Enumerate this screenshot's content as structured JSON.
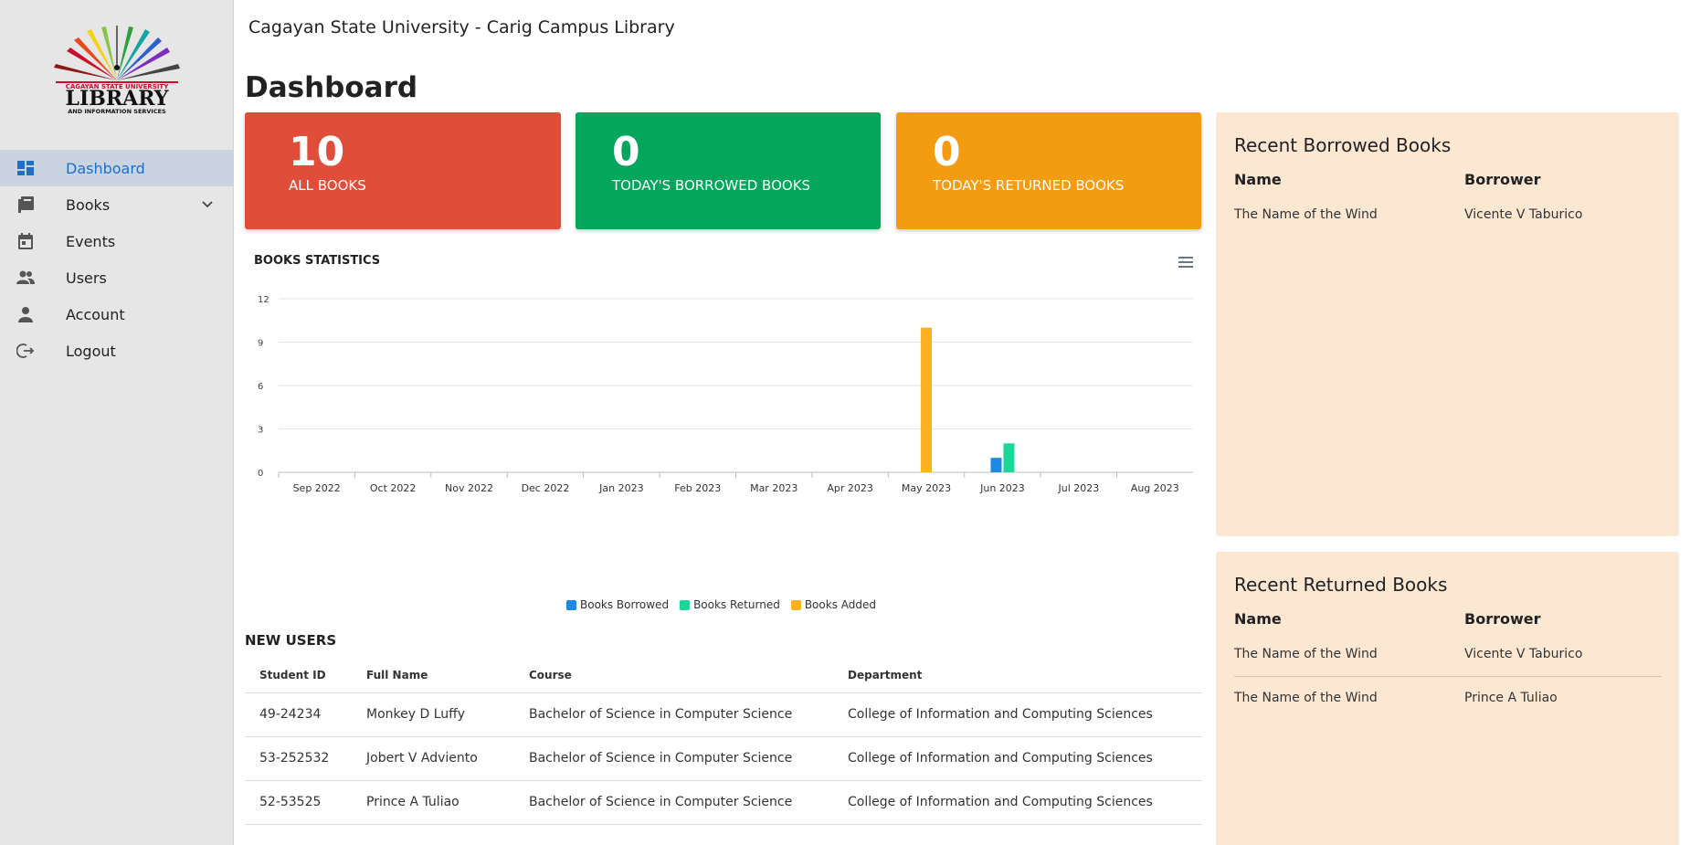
{
  "site": {
    "title": "Cagayan State University - Carig Campus Library"
  },
  "logo": {
    "text_top": "CAGAYAN STATE UNIVERSITY",
    "text_main": "LIBRARY",
    "text_bottom": "AND INFORMATION SERVICES"
  },
  "sidebar": {
    "items": [
      {
        "label": "Dashboard",
        "icon": "dashboard-icon",
        "active": true
      },
      {
        "label": "Books",
        "icon": "books-icon",
        "has_submenu": true
      },
      {
        "label": "Events",
        "icon": "calendar-icon"
      },
      {
        "label": "Users",
        "icon": "users-icon"
      },
      {
        "label": "Account",
        "icon": "person-icon"
      },
      {
        "label": "Logout",
        "icon": "logout-icon"
      }
    ]
  },
  "page": {
    "title": "Dashboard"
  },
  "stats": [
    {
      "value": "10",
      "label": "ALL BOOKS",
      "color": "#e04e3a"
    },
    {
      "value": "0",
      "label": "TODAY'S BORROWED BOOKS",
      "color": "#03a65a"
    },
    {
      "value": "0",
      "label": "TODAY'S RETURNED BOOKS",
      "color": "#f39c12"
    }
  ],
  "chart": {
    "title": "BOOKS STATISTICS",
    "menu_icon": "hamburger-menu-icon"
  },
  "chart_data": {
    "type": "bar",
    "title": "BOOKS STATISTICS",
    "categories": [
      "Sep 2022",
      "Oct 2022",
      "Nov 2022",
      "Dec 2022",
      "Jan 2023",
      "Feb 2023",
      "Mar 2023",
      "Apr 2023",
      "May 2023",
      "Jun 2023",
      "Jul 2023",
      "Aug 2023"
    ],
    "series": [
      {
        "name": "Books Borrowed",
        "color": "#1e88e5",
        "values": [
          0,
          0,
          0,
          0,
          0,
          0,
          0,
          0,
          0,
          1,
          0,
          0
        ]
      },
      {
        "name": "Books Returned",
        "color": "#18d99a",
        "values": [
          0,
          0,
          0,
          0,
          0,
          0,
          0,
          0,
          0,
          2,
          0,
          0
        ]
      },
      {
        "name": "Books Added",
        "color": "#fdb022",
        "values": [
          0,
          0,
          0,
          0,
          0,
          0,
          0,
          0,
          10,
          0,
          0,
          0
        ]
      }
    ],
    "ylim": [
      0,
      12
    ],
    "yticks": [
      0,
      3,
      6,
      9,
      12
    ],
    "grid": true,
    "legend": "bottom-center"
  },
  "new_users": {
    "title": "NEW USERS",
    "columns": [
      "Student ID",
      "Full Name",
      "Course",
      "Department"
    ],
    "rows": [
      [
        "49-24234",
        "Monkey D Luffy",
        "Bachelor of Science in Computer Science",
        "College of Information and Computing Sciences"
      ],
      [
        "53-252532",
        "Jobert V Adviento",
        "Bachelor of Science in Computer Science",
        "College of Information and Computing Sciences"
      ],
      [
        "52-53525",
        "Prince A Tuliao",
        "Bachelor of Science in Computer Science",
        "College of Information and Computing Sciences"
      ]
    ]
  },
  "recent_borrowed": {
    "title": "Recent Borrowed Books",
    "columns": [
      "Name",
      "Borrower"
    ],
    "rows": [
      [
        "The Name of the Wind",
        "Vicente V Taburico"
      ]
    ]
  },
  "recent_returned": {
    "title": "Recent Returned Books",
    "columns": [
      "Name",
      "Borrower"
    ],
    "rows": [
      [
        "The Name of the Wind",
        "Vicente V Taburico"
      ],
      [
        "The Name of the Wind",
        "Prince A Tuliao"
      ]
    ]
  }
}
